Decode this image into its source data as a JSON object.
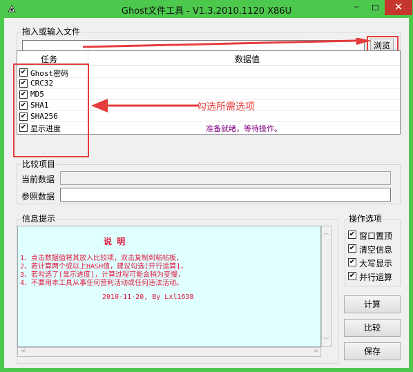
{
  "window": {
    "title": "Ghost文件工具 - V1.3.2010.1120 X86U",
    "minimize_icon": "minimize-icon",
    "maximize_icon": "maximize-icon",
    "close_icon": "close-icon",
    "app_icon": "app-icon",
    "titlebar_color": "#4cc94c",
    "close_color": "#c7362e"
  },
  "file_group": {
    "label": "拖入或输入文件",
    "input_value": "",
    "browse_label": "浏览"
  },
  "tasks": {
    "col_task": "任务",
    "col_value": "数据值",
    "rows": [
      {
        "label": "Ghost密码",
        "checked": true,
        "value": ""
      },
      {
        "label": "CRC32",
        "checked": true,
        "value": ""
      },
      {
        "label": "MD5",
        "checked": true,
        "value": ""
      },
      {
        "label": "SHA1",
        "checked": true,
        "value": ""
      },
      {
        "label": "SHA256",
        "checked": true,
        "value": ""
      },
      {
        "label": "显示进度",
        "checked": true,
        "value": "准备就绪，等待操作。"
      }
    ]
  },
  "annotation": {
    "text": "勾选所需选项",
    "color": "#e53c3c"
  },
  "compare_group": {
    "label": "比较项目",
    "current_label": "当前数据",
    "current_value": "",
    "reference_label": "参照数据",
    "reference_value": ""
  },
  "info_group": {
    "label": "信息提示",
    "heading": "说 明",
    "lines": [
      "1、点击数据值将其放入比较项，双击复制到粘帖板，",
      "2、若计算两个或以上HASH值，建议勾选[开行运算]，",
      "3、若勾选了[显示进度]，计算过程可能会稍为变慢，",
      "4、不要用本工具从事任何营利活动或任何违法活动。"
    ],
    "footer": "2010-11-20, By Lxl1638",
    "text_color": "#e0183c",
    "background": "#e0ffff"
  },
  "options_group": {
    "label": "操作选项",
    "items": [
      {
        "label": "窗口置顶",
        "checked": true
      },
      {
        "label": "清空信息",
        "checked": true
      },
      {
        "label": "大写显示",
        "checked": true
      },
      {
        "label": "并行运算",
        "checked": true
      }
    ]
  },
  "buttons": {
    "calculate": "计算",
    "compare": "比较",
    "save": "保存"
  },
  "checkmark": "✔"
}
